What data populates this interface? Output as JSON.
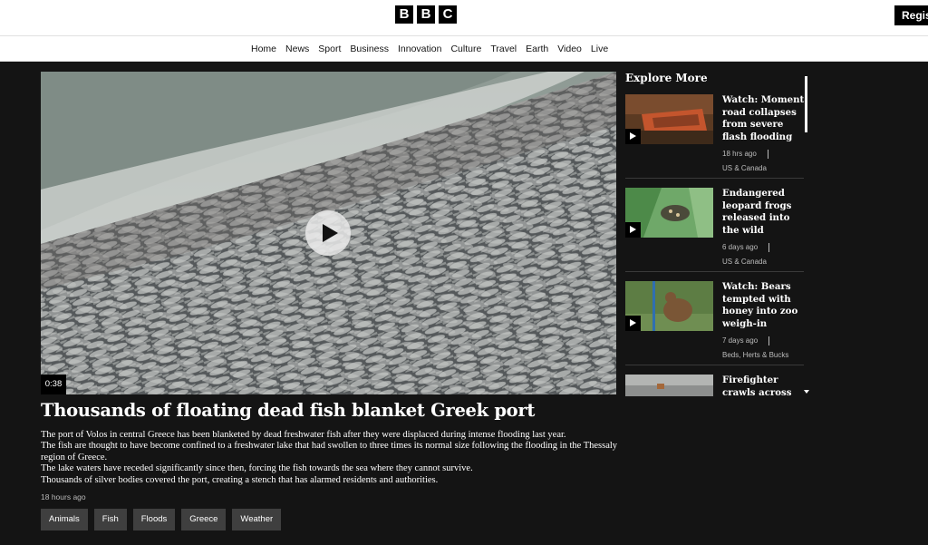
{
  "header": {
    "logo_letters": [
      "B",
      "B",
      "C"
    ],
    "register_label": "Regis"
  },
  "nav": {
    "items": [
      "Home",
      "News",
      "Sport",
      "Business",
      "Innovation",
      "Culture",
      "Travel",
      "Earth",
      "Video",
      "Live"
    ]
  },
  "video": {
    "duration": "0:38",
    "play_icon": "play-icon"
  },
  "article": {
    "headline": "Thousands of floating dead fish blanket Greek port",
    "paragraphs": [
      "The port of Volos in central Greece has been blanketed by dead freshwater fish after they were displaced during intense flooding last year.",
      "The fish are thought to have become confined to a freshwater lake that had swollen to three times its normal size following the flooding in the Thessaly region of Greece.",
      "The lake waters have receded significantly since then, forcing the fish towards the sea where they cannot survive.",
      "Thousands of silver bodies covered the port, creating a stench that has alarmed residents and authorities."
    ],
    "timestamp": "18 hours ago",
    "tags": [
      "Animals",
      "Fish",
      "Floods",
      "Greece",
      "Weather"
    ]
  },
  "explore": {
    "title": "Explore More",
    "cards": [
      {
        "title": "Watch: Moment road collapses from severe flash flooding",
        "time": "18 hrs ago",
        "category": "US & Canada"
      },
      {
        "title": "Endangered leopard frogs released into the wild",
        "time": "6 days ago",
        "category": "US & Canada"
      },
      {
        "title": "Watch: Bears tempted with honey into zoo weigh-in",
        "time": "7 days ago",
        "category": "Beds, Herts & Bucks"
      },
      {
        "title": "Firefighter crawls across",
        "time": "",
        "category": ""
      }
    ]
  },
  "colors": {
    "page_bg": "#141414",
    "header_bg": "#ffffff",
    "tag_bg": "#3f3f3f"
  }
}
